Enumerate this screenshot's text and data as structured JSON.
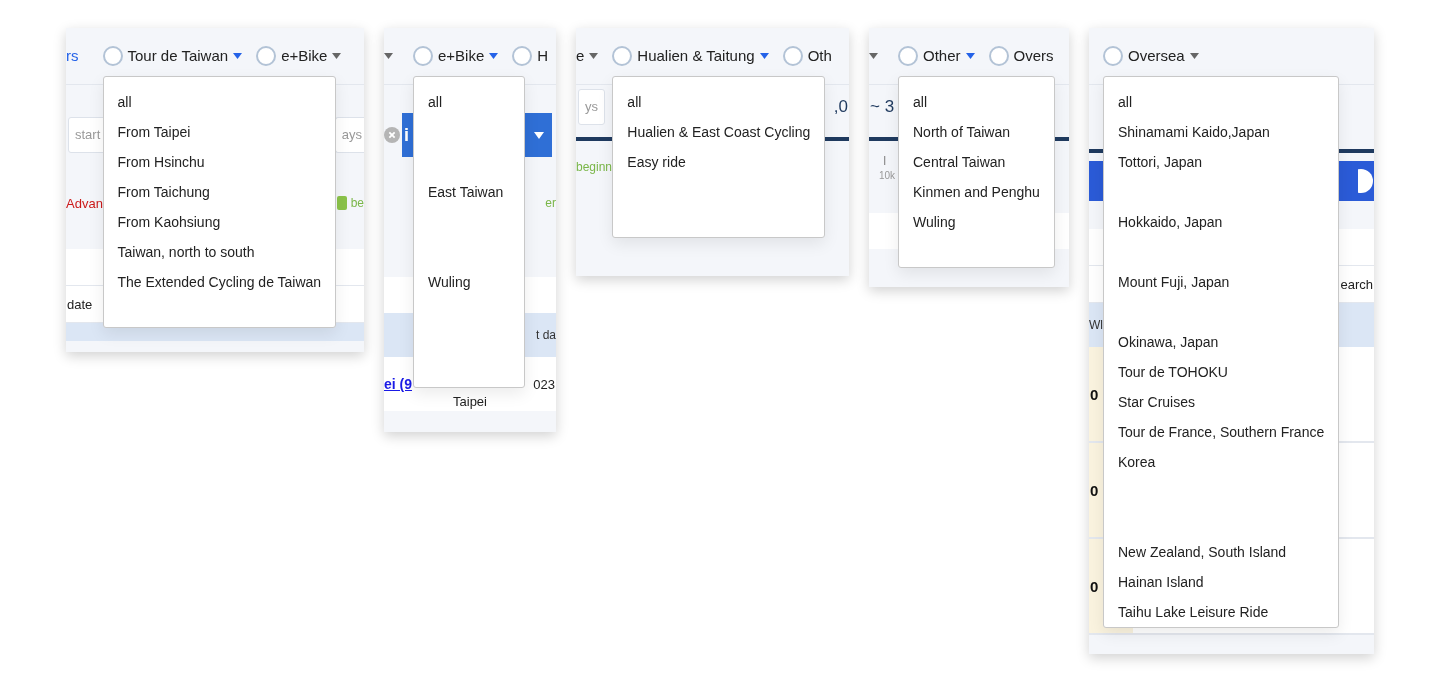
{
  "panels": [
    {
      "tabs": [
        {
          "kind": "link",
          "label": "rs"
        },
        {
          "kind": "radio",
          "label": "Tour de Taiwan",
          "highlighted": true,
          "menu": {
            "items": [
              {
                "kind": "item",
                "label": "all"
              },
              {
                "kind": "item",
                "label": "From Taipei"
              },
              {
                "kind": "item",
                "label": "From Hsinchu"
              },
              {
                "kind": "item",
                "label": "From Taichung"
              },
              {
                "kind": "item",
                "label": "From Kaohsiung"
              },
              {
                "kind": "item",
                "label": "Taiwan, north to south"
              },
              {
                "kind": "item",
                "label": "The Extended Cycling de Taiwan"
              },
              {
                "kind": "blank"
              }
            ]
          }
        },
        {
          "kind": "radio",
          "label": "e+Bike",
          "highlighted": false
        }
      ],
      "rows": [
        {
          "kind": "gap"
        },
        {
          "kind": "filter",
          "left": [
            {
              "kind": "field",
              "text": "start"
            }
          ],
          "right": [
            {
              "kind": "field",
              "text": "ays"
            }
          ]
        },
        {
          "kind": "gap"
        },
        {
          "kind": "tags",
          "left": [
            {
              "kind": "red",
              "text": "Advan"
            }
          ],
          "right": [
            {
              "kind": "badge",
              "text": "be"
            }
          ]
        },
        {
          "kind": "gap"
        },
        {
          "kind": "blank"
        },
        {
          "kind": "cell",
          "left": [
            {
              "kind": "plain",
              "text": "date"
            }
          ]
        },
        {
          "kind": "strip"
        }
      ]
    },
    {
      "tabs": [
        {
          "kind": "partial",
          "highlighted": false
        },
        {
          "kind": "radio",
          "label": "e+Bike",
          "highlighted": true,
          "menu": {
            "items": [
              {
                "kind": "item",
                "label": "all"
              },
              {
                "kind": "blank"
              },
              {
                "kind": "blank"
              },
              {
                "kind": "item",
                "label": "East Taiwan"
              },
              {
                "kind": "blank"
              },
              {
                "kind": "blank"
              },
              {
                "kind": "item",
                "label": "Wuling"
              },
              {
                "kind": "blank"
              },
              {
                "kind": "blank"
              },
              {
                "kind": "blank"
              }
            ]
          }
        },
        {
          "kind": "radio",
          "label": "H"
        }
      ],
      "rows": [
        {
          "kind": "gap"
        },
        {
          "kind": "filter",
          "left": [
            {
              "kind": "clear"
            },
            {
              "kind": "select",
              "text": "i"
            }
          ]
        },
        {
          "kind": "gap"
        },
        {
          "kind": "tags",
          "right": [
            {
              "kind": "green",
              "text": "er"
            }
          ]
        },
        {
          "kind": "gap"
        },
        {
          "kind": "gap"
        },
        {
          "kind": "blank"
        },
        {
          "kind": "head",
          "right": [
            {
              "kind": "header",
              "text": "t da"
            }
          ]
        },
        {
          "kind": "row",
          "left": [
            {
              "kind": "ulink",
              "text": "ei (9"
            }
          ],
          "middle": [
            {
              "kind": "plain",
              "text": "Taipei"
            }
          ],
          "right": [
            {
              "kind": "plain",
              "text": "023"
            }
          ]
        }
      ]
    },
    {
      "tabs": [
        {
          "kind": "partial",
          "label": "e",
          "highlighted": false
        },
        {
          "kind": "radio",
          "label": "Hualien & Taitung",
          "highlighted": true,
          "menu": {
            "items": [
              {
                "kind": "item",
                "label": "all"
              },
              {
                "kind": "item",
                "label": "Hualien & East Coast Cycling"
              },
              {
                "kind": "item",
                "label": "Easy ride"
              },
              {
                "kind": "blank"
              },
              {
                "kind": "blank"
              }
            ]
          }
        },
        {
          "kind": "radio",
          "label": "Oth"
        }
      ],
      "rows": [
        {
          "kind": "filter",
          "left": [
            {
              "kind": "field",
              "text": "ys"
            }
          ],
          "right": [
            {
              "kind": "number",
              "text": ",0"
            }
          ]
        },
        {
          "kind": "rule"
        },
        {
          "kind": "tags",
          "left": [
            {
              "kind": "green",
              "text": "beginn"
            }
          ]
        },
        {
          "kind": "gap"
        }
      ]
    },
    {
      "tabs": [
        {
          "kind": "partial",
          "highlighted": false
        },
        {
          "kind": "radio",
          "label": "Other",
          "highlighted": true,
          "menu": {
            "items": [
              {
                "kind": "item",
                "label": "all"
              },
              {
                "kind": "item",
                "label": "North of Taiwan"
              },
              {
                "kind": "item",
                "label": "Central Taiwan"
              },
              {
                "kind": "item",
                "label": "Kinmen and Penghu"
              },
              {
                "kind": "item",
                "label": "Wuling"
              },
              {
                "kind": "blank"
              }
            ]
          }
        },
        {
          "kind": "radio",
          "label": "Overs"
        }
      ],
      "rows": [
        {
          "kind": "stat",
          "left": [
            {
              "kind": "number",
              "text": "~ 3"
            }
          ]
        },
        {
          "kind": "rule"
        },
        {
          "kind": "ticks",
          "left": [
            {
              "kind": "tick",
              "text": "I"
            },
            {
              "kind": "small",
              "text": "10k"
            }
          ]
        },
        {
          "kind": "gap"
        },
        {
          "kind": "blank"
        }
      ]
    },
    {
      "tabs": [
        {
          "kind": "radio",
          "label": "Oversea",
          "highlighted": false,
          "menu": {
            "items": [
              {
                "kind": "item",
                "label": "all"
              },
              {
                "kind": "item",
                "label": "Shinamami Kaido,Japan"
              },
              {
                "kind": "item",
                "label": "Tottori, Japan"
              },
              {
                "kind": "blank"
              },
              {
                "kind": "item",
                "label": "Hokkaido, Japan"
              },
              {
                "kind": "blank"
              },
              {
                "kind": "item",
                "label": "Mount Fuji, Japan"
              },
              {
                "kind": "blank"
              },
              {
                "kind": "item",
                "label": "Okinawa, Japan"
              },
              {
                "kind": "item",
                "label": "Tour de TOHOKU"
              },
              {
                "kind": "item",
                "label": "Star Cruises"
              },
              {
                "kind": "item",
                "label": "Tour de France, Southern France"
              },
              {
                "kind": "item",
                "label": "Korea"
              },
              {
                "kind": "blank"
              },
              {
                "kind": "blank"
              },
              {
                "kind": "item",
                "label": "New Zealand, South Island"
              },
              {
                "kind": "item",
                "label": "Hainan Island"
              },
              {
                "kind": "item",
                "label": "Taihu Lake Leisure Ride"
              }
            ]
          }
        }
      ],
      "rows": [
        {
          "kind": "gap"
        },
        {
          "kind": "gap"
        },
        {
          "kind": "rule"
        },
        {
          "kind": "bar",
          "right": [
            {
              "kind": "knob"
            }
          ]
        },
        {
          "kind": "gap"
        },
        {
          "kind": "blank"
        },
        {
          "kind": "cell",
          "right": [
            {
              "kind": "plain",
              "text": "earch"
            }
          ]
        },
        {
          "kind": "head",
          "left": [
            {
              "kind": "header",
              "text": "Wl"
            }
          ]
        },
        {
          "kind": "tall",
          "left": [
            {
              "kind": "bold",
              "text": "0"
            }
          ]
        },
        {
          "kind": "tall",
          "left": [
            {
              "kind": "bold",
              "text": "0"
            }
          ]
        },
        {
          "kind": "tall",
          "left": [
            {
              "kind": "bold",
              "text": "0"
            }
          ]
        }
      ]
    }
  ]
}
